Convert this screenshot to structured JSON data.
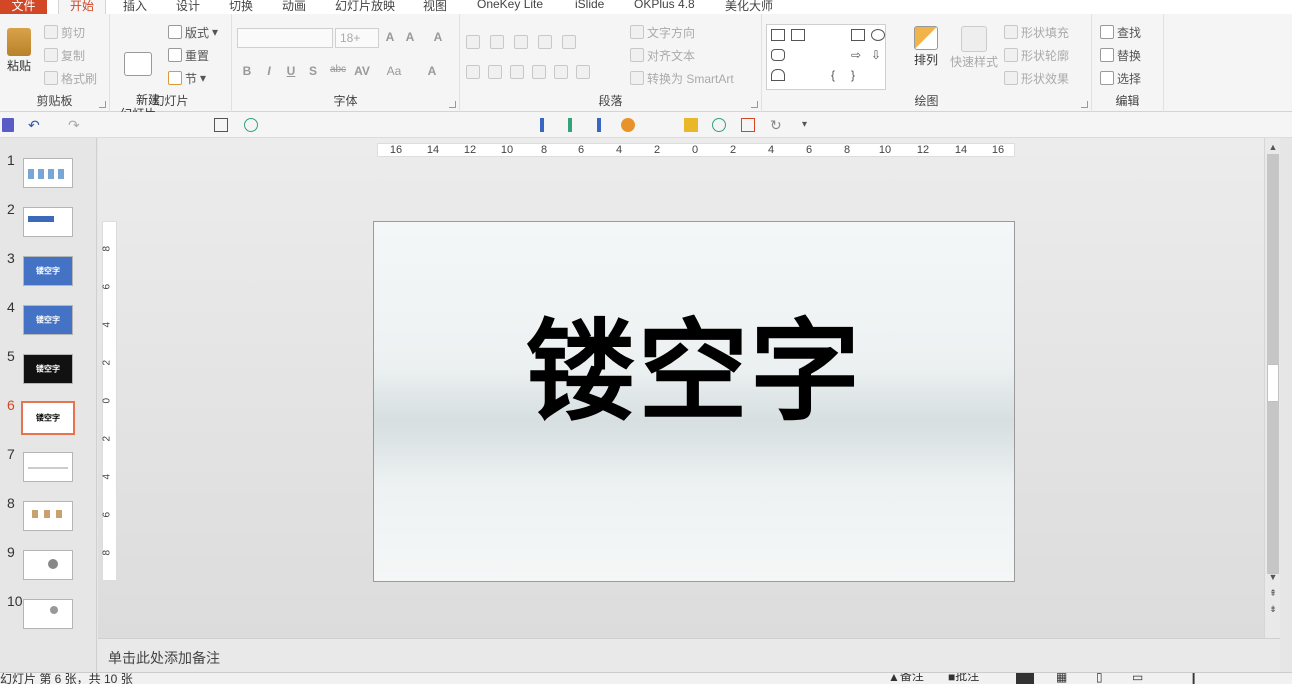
{
  "ribbon_tabs": [
    "文件",
    "开始",
    "插入",
    "设计",
    "切换",
    "动画",
    "幻灯片放映",
    "视图",
    "OneKey Lite",
    "iSlide",
    "OKPlus 4.8",
    "美化大师"
  ],
  "clipboard": {
    "paste": "粘贴",
    "cut": "剪切",
    "copy": "复制",
    "format_painter": "格式刷",
    "label": "剪贴板"
  },
  "slides_group": {
    "new_slide": "新建\n幻灯片",
    "layout": "版式",
    "reset": "重置",
    "section": "节",
    "label": "幻灯片"
  },
  "font_group": {
    "size": "18+",
    "bold": "B",
    "italic": "I",
    "underline": "U",
    "shadow": "S",
    "strike": "abc",
    "spacing": "AV",
    "case": "Aa",
    "color": "A",
    "grow": "A",
    "shrink": "A",
    "clear": "A",
    "label": "字体"
  },
  "paragraph_group": {
    "text_direction": "文字方向",
    "align_text": "对齐文本",
    "smartart": "转换为 SmartArt",
    "label": "段落"
  },
  "drawing_group": {
    "arrange": "排列",
    "quick_styles": "快速样式",
    "shape_fill": "形状填充",
    "shape_outline": "形状轮廓",
    "shape_effects": "形状效果",
    "label": "绘图"
  },
  "editing_group": {
    "find": "查找",
    "replace": "替换",
    "select": "选择",
    "label": "编辑"
  },
  "thumbnails": [
    {
      "num": "1",
      "text": ""
    },
    {
      "num": "2",
      "text": ""
    },
    {
      "num": "3",
      "text": "镂空字"
    },
    {
      "num": "4",
      "text": "镂空字"
    },
    {
      "num": "5",
      "text": "镂空字"
    },
    {
      "num": "6",
      "text": "镂空字"
    },
    {
      "num": "7",
      "text": ""
    },
    {
      "num": "8",
      "text": ""
    },
    {
      "num": "9",
      "text": ""
    },
    {
      "num": "10",
      "text": ""
    }
  ],
  "ruler_h": [
    "16",
    "14",
    "12",
    "10",
    "8",
    "6",
    "4",
    "2",
    "0",
    "2",
    "4",
    "6",
    "8",
    "10",
    "12",
    "14",
    "16"
  ],
  "ruler_v": [
    "8",
    "6",
    "4",
    "2",
    "0",
    "2",
    "4",
    "6",
    "8"
  ],
  "slide": {
    "title": "镂空字"
  },
  "notes_placeholder": "单击此处添加备注",
  "status": {
    "slide_info": "幻灯片 第 6 张，共 10 张",
    "notes": "备注",
    "comments": "批注"
  },
  "colors": {
    "accent": "#d24726",
    "selected_border": "#e8734f"
  }
}
